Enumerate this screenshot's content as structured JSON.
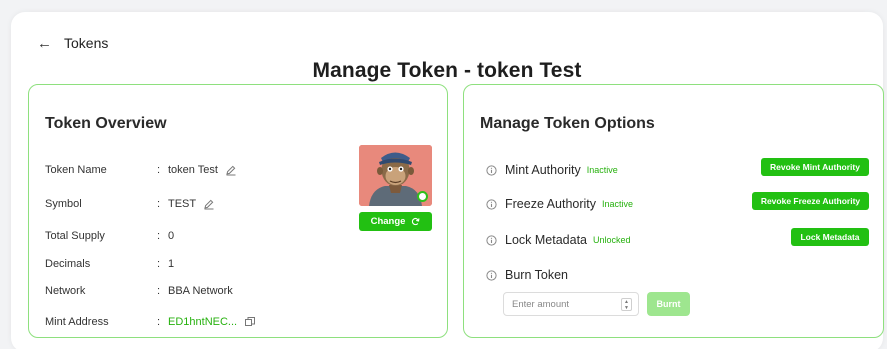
{
  "header": {
    "back_label": "Tokens",
    "title": "Manage Token - token Test"
  },
  "overview": {
    "title": "Token Overview",
    "fields": [
      {
        "label": "Token Name",
        "value": "token Test"
      },
      {
        "label": "Symbol",
        "value": "TEST"
      },
      {
        "label": "Total Supply",
        "value": "0"
      },
      {
        "label": "Decimals",
        "value": "1"
      },
      {
        "label": "Network",
        "value": "BBA Network"
      },
      {
        "label": "Mint Address",
        "value": "ED1hntNEC..."
      }
    ],
    "colon": ":",
    "change_label": "Change"
  },
  "options": {
    "title": "Manage Token Options",
    "mint": {
      "label": "Mint Authority",
      "status": "Inactive",
      "action": "Revoke Mint Authority"
    },
    "freeze": {
      "label": "Freeze Authority",
      "status": "Inactive",
      "action": "Revoke Freeze Authority"
    },
    "lock": {
      "label": "Lock Metadata",
      "status": "Unlocked",
      "action": "Lock Metadata"
    },
    "burn": {
      "label": "Burn Token",
      "placeholder": "Enter amount",
      "action": "Burnt"
    }
  },
  "colors": {
    "accent": "#22c012",
    "panel_border": "#8ee07e",
    "disabled_accent": "#9ee68f",
    "status_text": "#27b10f"
  }
}
